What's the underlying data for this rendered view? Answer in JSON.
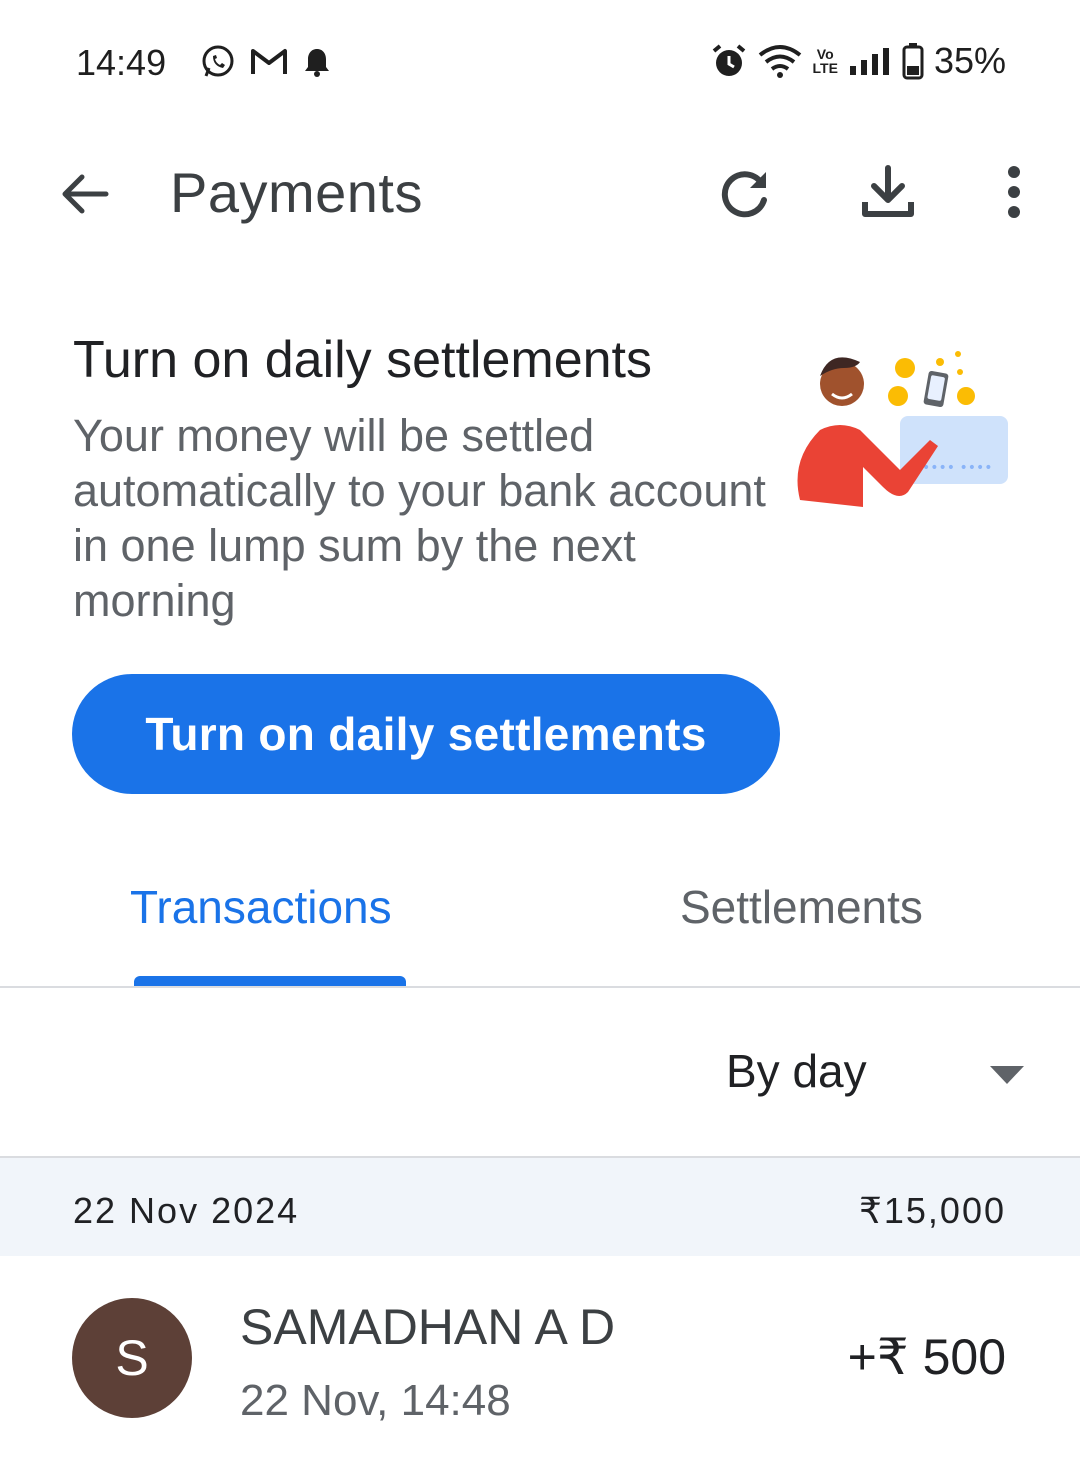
{
  "status_bar": {
    "time": "14:49",
    "left_icons": [
      "whatsapp-icon",
      "gmail-icon",
      "notification-bell-icon"
    ],
    "right_icons": [
      "alarm-icon",
      "wifi-icon",
      "volte-icon",
      "signal-icon",
      "battery-icon"
    ],
    "volte_top": "Vo",
    "volte_bottom": "LTE",
    "battery": "35%"
  },
  "appbar": {
    "title": "Payments",
    "icons": [
      "back-arrow-icon",
      "refresh-icon",
      "download-icon",
      "more-vert-icon"
    ]
  },
  "banner": {
    "title": "Turn on daily settlements",
    "description": "Your money will be settled automatically to your bank account in one lump sum by the next morning",
    "button_label": "Turn on daily settlements",
    "illustration_card_text": "•••• ••••"
  },
  "tabs": [
    {
      "label": "Transactions",
      "active": true
    },
    {
      "label": "Settlements",
      "active": false
    }
  ],
  "filter": {
    "selected": "By day"
  },
  "date_group": {
    "date": "22 Nov 2024",
    "total": "₹15,000"
  },
  "transactions": [
    {
      "avatar_letter": "S",
      "name": "SAMADHAN A D",
      "time": "22 Nov, 14:48",
      "amount": "+₹ 500"
    }
  ],
  "colors": {
    "accent": "#1a73e8",
    "avatar": "#5d4037",
    "date_header_bg": "#f1f5fa"
  }
}
